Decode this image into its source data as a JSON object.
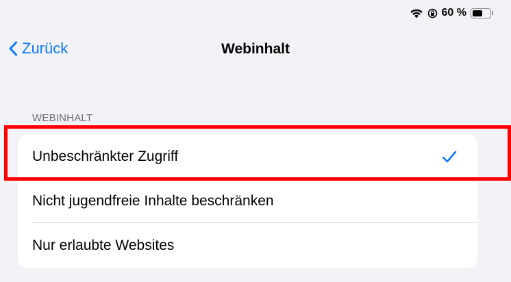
{
  "status_bar": {
    "battery_text": "60 %",
    "battery_level": 0.6,
    "icons": [
      "wifi-icon",
      "rotation-lock-icon",
      "battery-icon"
    ]
  },
  "nav": {
    "back_label": "Zurück",
    "title": "Webinhalt"
  },
  "section": {
    "header": "WEBINHALT",
    "rows": [
      {
        "label": "Unbeschränkter Zugriff",
        "selected": true
      },
      {
        "label": "Nicht jugendfreie Inhalte beschränken",
        "selected": false
      },
      {
        "label": "Nur erlaubte Websites",
        "selected": false
      }
    ]
  },
  "colors": {
    "accent": "#0a7aff",
    "highlight": "#ff0000",
    "background": "#f2f2f7"
  }
}
